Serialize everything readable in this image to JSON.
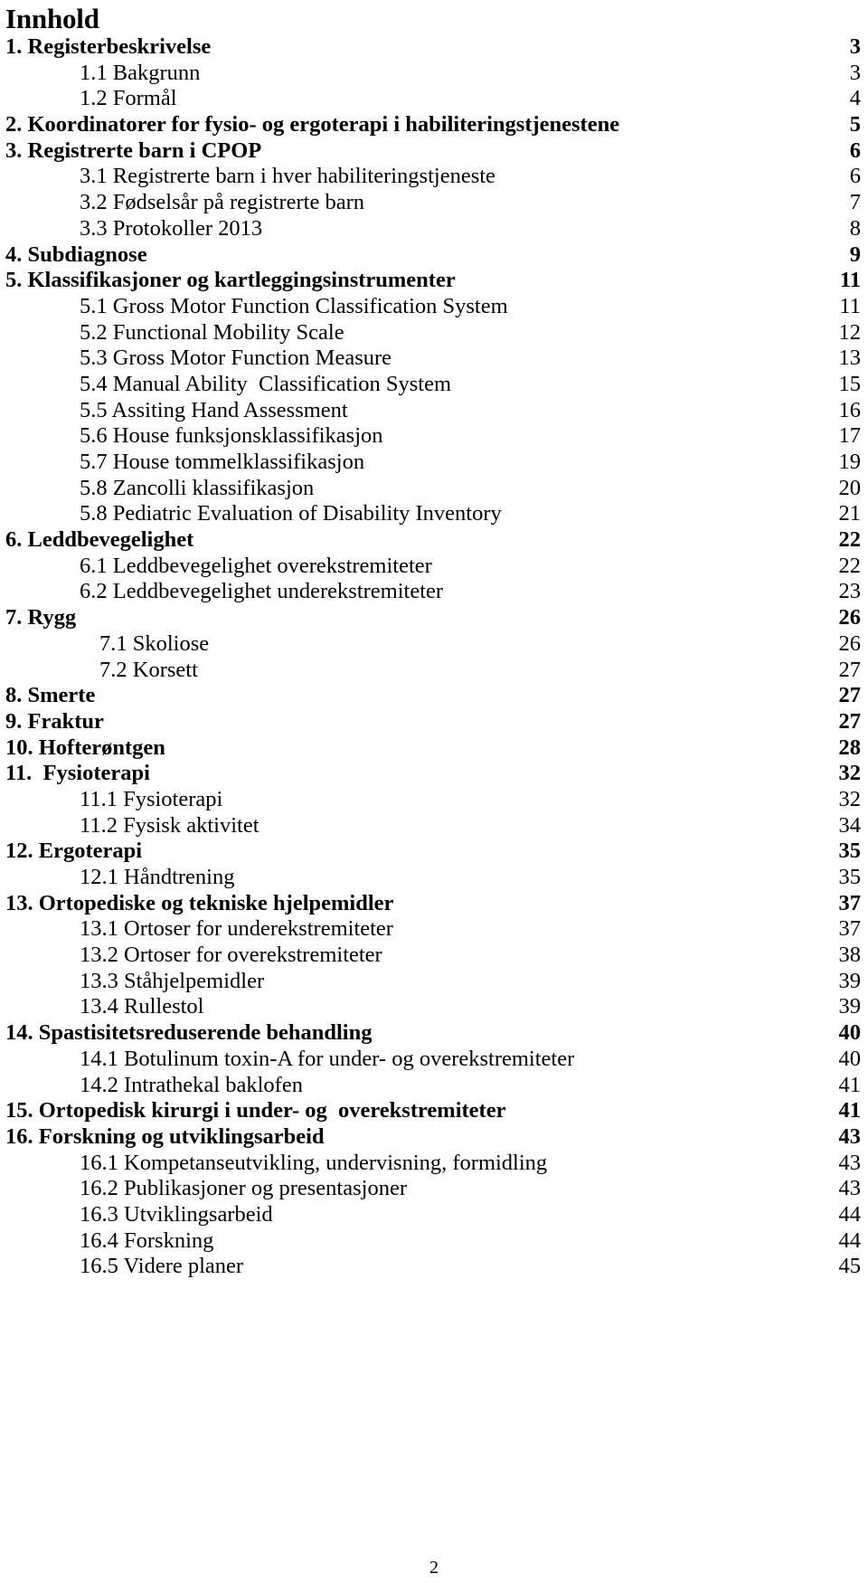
{
  "document": {
    "title": "Innhold",
    "page_footer": "2"
  },
  "toc": {
    "entries": [
      {
        "label": "1. Registerbeskrivelse",
        "page": "3",
        "level": 1,
        "indent_extra": false
      },
      {
        "label": "1.1 Bakgrunn",
        "page": "3",
        "level": 2,
        "indent_extra": false
      },
      {
        "label": "1.2 Formål",
        "page": "4",
        "level": 2,
        "indent_extra": false
      },
      {
        "label": "2. Koordinatorer for fysio- og ergoterapi i habiliteringstjenestene",
        "page": "5",
        "level": 1,
        "indent_extra": false
      },
      {
        "label": "3. Registrerte barn i CPOP",
        "page": "6",
        "level": 1,
        "indent_extra": false
      },
      {
        "label": "3.1 Registrerte barn i hver habiliteringstjeneste",
        "page": "6",
        "level": 2,
        "indent_extra": false
      },
      {
        "label": "3.2 Fødselsår på registrerte barn",
        "page": "7",
        "level": 2,
        "indent_extra": false
      },
      {
        "label": "3.3 Protokoller 2013",
        "page": "8",
        "level": 2,
        "indent_extra": false
      },
      {
        "label": "4. Subdiagnose",
        "page": "9",
        "level": 1,
        "indent_extra": false
      },
      {
        "label": "5. Klassifikasjoner og kartleggingsinstrumenter",
        "page": "11",
        "level": 1,
        "indent_extra": false
      },
      {
        "label": "5.1 Gross Motor Function Classification System",
        "page": "11",
        "level": 2,
        "indent_extra": false
      },
      {
        "label": "5.2 Functional Mobility Scale",
        "page": "12",
        "level": 2,
        "indent_extra": false
      },
      {
        "label": "5.3 Gross Motor Function Measure",
        "page": "13",
        "level": 2,
        "indent_extra": false
      },
      {
        "label": "5.4 Manual Ability  Classification System",
        "page": "15",
        "level": 2,
        "indent_extra": false
      },
      {
        "label": "5.5 Assiting Hand Assessment",
        "page": "16",
        "level": 2,
        "indent_extra": false
      },
      {
        "label": "5.6 House funksjonsklassifikasjon",
        "page": "17",
        "level": 2,
        "indent_extra": false
      },
      {
        "label": "5.7 House tommelklassifikasjon",
        "page": "19",
        "level": 2,
        "indent_extra": false
      },
      {
        "label": "5.8 Zancolli klassifikasjon",
        "page": "20",
        "level": 2,
        "indent_extra": false
      },
      {
        "label": "5.8 Pediatric Evaluation of Disability Inventory",
        "page": "21",
        "level": 2,
        "indent_extra": false
      },
      {
        "label": "6. Leddbevegelighet",
        "page": "22",
        "level": 1,
        "indent_extra": false
      },
      {
        "label": "6.1 Leddbevegelighet overekstremiteter",
        "page": "22",
        "level": 2,
        "indent_extra": false
      },
      {
        "label": "6.2 Leddbevegelighet underekstremiteter",
        "page": "23",
        "level": 2,
        "indent_extra": false
      },
      {
        "label": "7. Rygg",
        "page": "26",
        "level": 1,
        "indent_extra": false
      },
      {
        "label": "7.1 Skoliose",
        "page": "26",
        "level": 2,
        "indent_extra": true
      },
      {
        "label": "7.2 Korsett",
        "page": "27",
        "level": 2,
        "indent_extra": true
      },
      {
        "label": "8. Smerte",
        "page": "27",
        "level": 1,
        "indent_extra": false
      },
      {
        "label": "9. Fraktur",
        "page": "27",
        "level": 1,
        "indent_extra": false
      },
      {
        "label": "10. Hofterøntgen",
        "page": "28",
        "level": 1,
        "indent_extra": false
      },
      {
        "label": "11.  Fysioterapi",
        "page": "32",
        "level": 1,
        "indent_extra": false
      },
      {
        "label": "11.1 Fysioterapi",
        "page": "32",
        "level": 2,
        "indent_extra": false
      },
      {
        "label": "11.2 Fysisk aktivitet",
        "page": "34",
        "level": 2,
        "indent_extra": false
      },
      {
        "label": "12. Ergoterapi",
        "page": "35",
        "level": 1,
        "indent_extra": false
      },
      {
        "label": "12.1 Håndtrening",
        "page": "35",
        "level": 2,
        "indent_extra": false
      },
      {
        "label": "13. Ortopediske og tekniske hjelpemidler",
        "page": "37",
        "level": 1,
        "indent_extra": false
      },
      {
        "label": "13.1 Ortoser for underekstremiteter",
        "page": "37",
        "level": 2,
        "indent_extra": false
      },
      {
        "label": "13.2 Ortoser for overekstremiteter",
        "page": "38",
        "level": 2,
        "indent_extra": false
      },
      {
        "label": "13.3 Ståhjelpemidler",
        "page": "39",
        "level": 2,
        "indent_extra": false
      },
      {
        "label": "13.4 Rullestol",
        "page": "39",
        "level": 2,
        "indent_extra": false
      },
      {
        "label": "14. Spastisitetsreduserende behandling",
        "page": "40",
        "level": 1,
        "indent_extra": false
      },
      {
        "label": "14.1 Botulinum toxin-A for under- og overekstremiteter",
        "page": "40",
        "level": 2,
        "indent_extra": false
      },
      {
        "label": "14.2 Intrathekal baklofen",
        "page": "41",
        "level": 2,
        "indent_extra": false
      },
      {
        "label": "15. Ortopedisk kirurgi i under- og  overekstremiteter",
        "page": "41",
        "level": 1,
        "indent_extra": false
      },
      {
        "label": "16. Forskning og utviklingsarbeid",
        "page": "43",
        "level": 1,
        "indent_extra": false
      },
      {
        "label": "16.1 Kompetanseutvikling, undervisning, formidling",
        "page": "43",
        "level": 2,
        "indent_extra": false
      },
      {
        "label": "16.2 Publikasjoner og presentasjoner",
        "page": "43",
        "level": 2,
        "indent_extra": false
      },
      {
        "label": "16.3 Utviklingsarbeid",
        "page": "44",
        "level": 2,
        "indent_extra": false
      },
      {
        "label": "16.4 Forskning",
        "page": "44",
        "level": 2,
        "indent_extra": false
      },
      {
        "label": "16.5 Videre planer",
        "page": "45",
        "level": 2,
        "indent_extra": false
      }
    ]
  }
}
